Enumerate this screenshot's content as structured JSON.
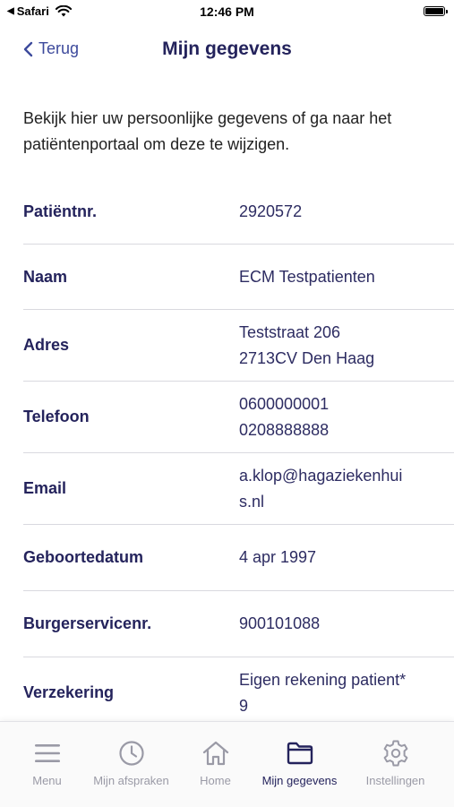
{
  "status_bar": {
    "back_app": "Safari",
    "time": "12:46 PM"
  },
  "nav": {
    "back_label": "Terug",
    "title": "Mijn gegevens"
  },
  "intro_text": "Bekijk hier uw persoonlijke gegevens of ga naar het patiëntenportaal om deze te wijzigen.",
  "fields": [
    {
      "label": "Patiëntnr.",
      "lines": [
        "2920572"
      ]
    },
    {
      "label": "Naam",
      "lines": [
        "ECM Testpatienten"
      ]
    },
    {
      "label": "Adres",
      "lines": [
        "Teststraat 206",
        "2713CV Den Haag"
      ]
    },
    {
      "label": "Telefoon",
      "lines": [
        "0600000001",
        "0208888888"
      ]
    },
    {
      "label": "Email",
      "lines": [
        "a.klop@hagaziekenhui",
        "s.nl"
      ]
    },
    {
      "label": "Geboortedatum",
      "lines": [
        "4 apr 1997"
      ]
    },
    {
      "label": "Burgerservicenr.",
      "lines": [
        "900101088"
      ]
    },
    {
      "label": "Verzekering",
      "lines": [
        "Eigen rekening patient*",
        "9"
      ]
    }
  ],
  "tabbar": {
    "tabs": [
      {
        "label": "Menu",
        "icon": "hamburger-icon"
      },
      {
        "label": "Mijn afspraken",
        "icon": "clock-icon"
      },
      {
        "label": "Home",
        "icon": "home-icon"
      },
      {
        "label": "Mijn gegevens",
        "icon": "folder-icon"
      },
      {
        "label": "Instellingen",
        "icon": "gear-icon"
      }
    ],
    "active_index": 3
  },
  "colors": {
    "primary": "#24235c",
    "accent": "#3d4a9c",
    "inactive": "#9a9aa6"
  }
}
